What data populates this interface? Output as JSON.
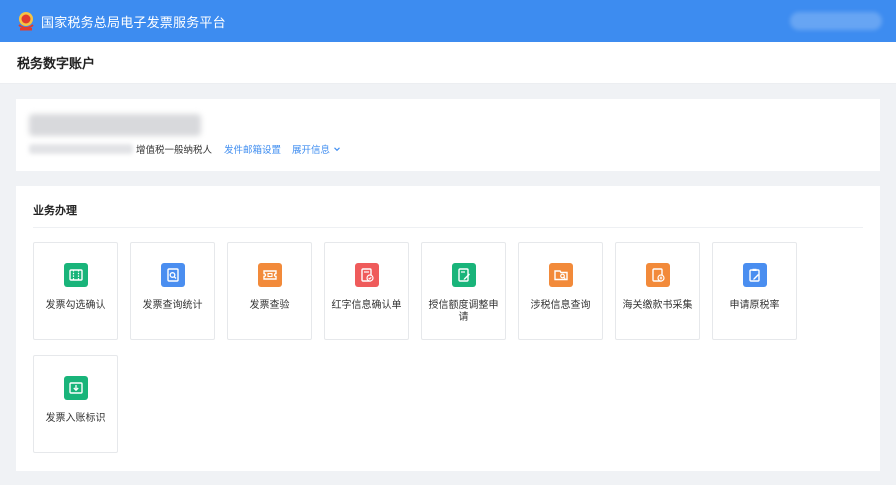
{
  "header": {
    "platform_title": "国家税务总局电子发票服务平台"
  },
  "page": {
    "title": "税务数字账户"
  },
  "account": {
    "taxpayer_type": "增值税一般纳税人",
    "email_setting_link": "发件邮箱设置",
    "expand_link": "展开信息"
  },
  "business": {
    "section_title": "业务办理",
    "tiles": [
      {
        "label": "发票勾选确认",
        "icon": "ticket-check-icon",
        "color": "#19b47a"
      },
      {
        "label": "发票查询统计",
        "icon": "document-search-icon",
        "color": "#4a8ef0"
      },
      {
        "label": "发票查验",
        "icon": "ticket-verify-icon",
        "color": "#f28a3a"
      },
      {
        "label": "红字信息确认单",
        "icon": "document-check-icon",
        "color": "#ef5b5b"
      },
      {
        "label": "授信额度调整申请",
        "icon": "document-edit-icon",
        "color": "#19b47a"
      },
      {
        "label": "涉税信息查询",
        "icon": "folder-search-icon",
        "color": "#f28a3a"
      },
      {
        "label": "海关缴款书采集",
        "icon": "document-money-icon",
        "color": "#f28a3a"
      },
      {
        "label": "申请原税率",
        "icon": "clipboard-edit-icon",
        "color": "#4a8ef0"
      },
      {
        "label": "发票入账标识",
        "icon": "ticket-download-icon",
        "color": "#19b47a"
      }
    ]
  }
}
